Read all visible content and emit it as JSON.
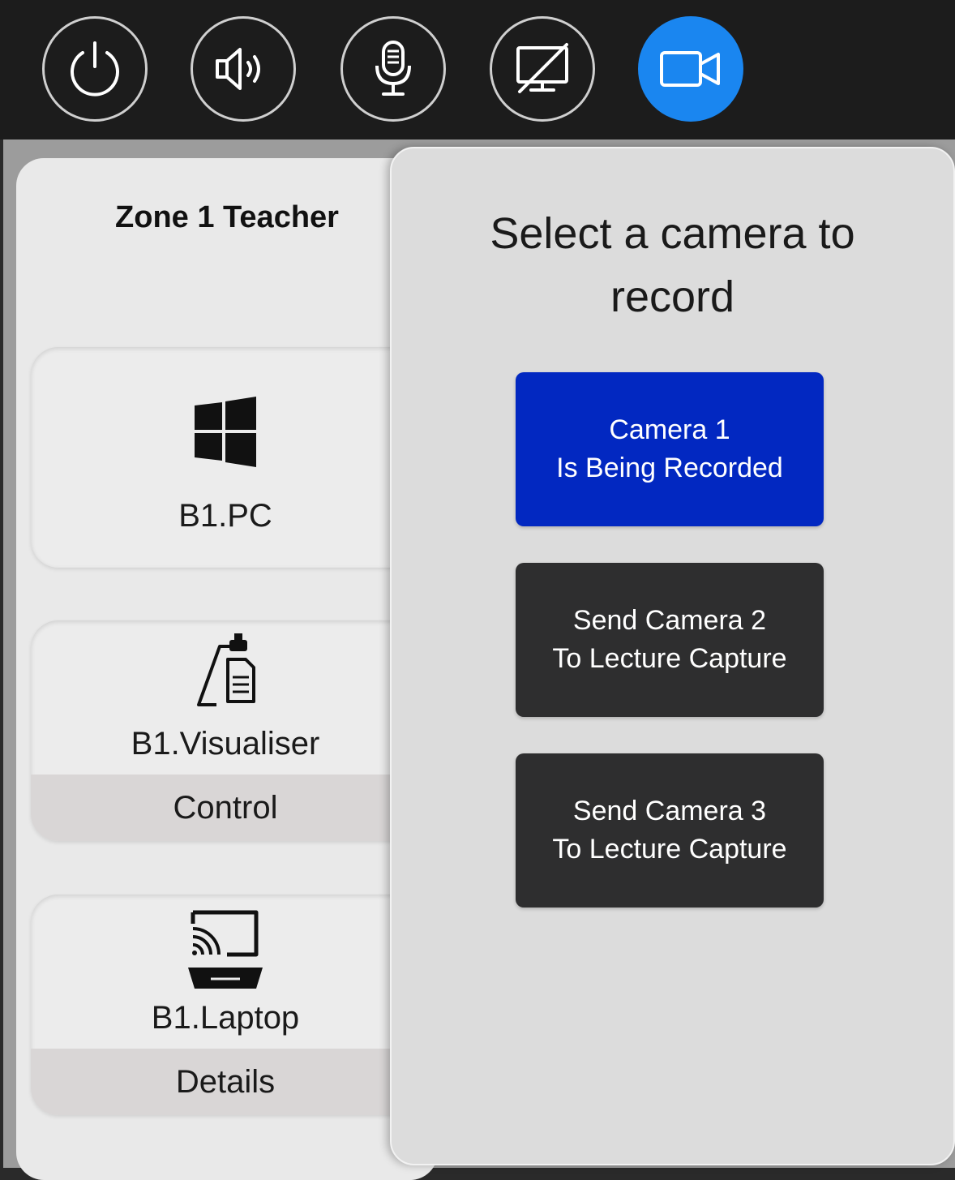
{
  "toolbar": {
    "buttons": [
      {
        "icon": "power-icon",
        "active": false
      },
      {
        "icon": "volume-icon",
        "active": false
      },
      {
        "icon": "microphone-icon",
        "active": false
      },
      {
        "icon": "display-off-icon",
        "active": false
      },
      {
        "icon": "camera-icon",
        "active": true
      }
    ],
    "active_color": "#1a86f0"
  },
  "left_panel": {
    "zone_title": "Zone 1 Teacher",
    "sources": [
      {
        "icon": "windows-icon",
        "label": "B1.PC",
        "action": ""
      },
      {
        "icon": "visualiser-icon",
        "label": "B1.Visualiser",
        "action": "Control"
      },
      {
        "icon": "cast-laptop-icon",
        "label": "B1.Laptop",
        "action": "Details"
      }
    ]
  },
  "camera_panel": {
    "title_line1": "Select a camera to",
    "title_line2": "record",
    "buttons": [
      {
        "line1": "Camera 1",
        "line2": "Is Being Recorded",
        "active": true
      },
      {
        "line1": "Send Camera 2",
        "line2": "To Lecture Capture",
        "active": false
      },
      {
        "line1": "Send Camera 3",
        "line2": "To Lecture Capture",
        "active": false
      }
    ],
    "active_color": "#0228c1",
    "inactive_color": "#2e2e2f"
  }
}
